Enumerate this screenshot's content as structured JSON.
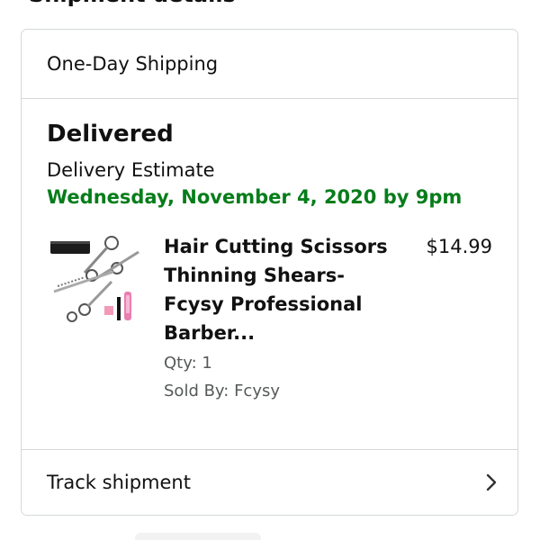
{
  "section": {
    "heading": "Shipment details"
  },
  "shipping": {
    "method": "One-Day Shipping"
  },
  "status": {
    "title": "Delivered",
    "estimate_label": "Delivery Estimate",
    "estimate_date": "Wednesday, November 4, 2020 by 9pm",
    "estimate_color": "#067d1a"
  },
  "product": {
    "title_lines": [
      "Hair Cutting Scissors",
      "Thinning Shears-",
      "Fcysy Professional",
      "Barber..."
    ],
    "price": "$14.99",
    "qty": "Qty: 1",
    "seller": "Sold By: Fcysy",
    "thumbnail_icon": "scissors-kit-thumbnail"
  },
  "track": {
    "label": "Track shipment",
    "icon": "chevron-right-icon"
  }
}
